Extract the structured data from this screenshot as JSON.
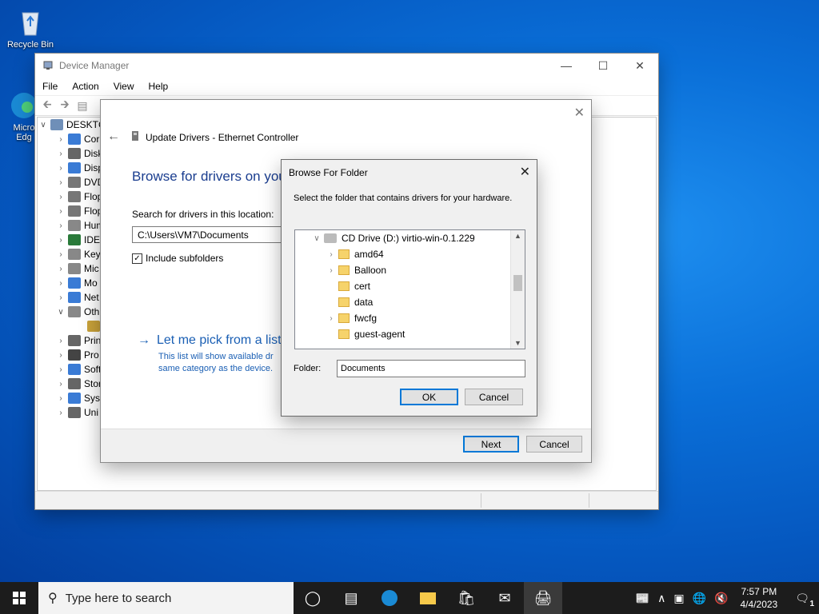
{
  "desktop": {
    "icons": [
      {
        "label": "Recycle Bin"
      },
      {
        "label": "Microsoft Edge",
        "label_line1": "Micro",
        "label_line2": "Edg"
      }
    ]
  },
  "device_manager": {
    "title": "Device Manager",
    "menu": [
      "File",
      "Action",
      "View",
      "Help"
    ],
    "tree": {
      "root": "DESKTC",
      "items": [
        "Cor",
        "Disk",
        "Disp",
        "DVD",
        "Flop",
        "Flop",
        "Hum",
        "IDE",
        "Key",
        "Mic",
        "Mo",
        "Net",
        "Oth",
        "",
        "Prin",
        "Pro",
        "Soft",
        "Stor",
        "Syst",
        "Uni"
      ]
    }
  },
  "update_drivers": {
    "header": "Update Drivers - Ethernet Controller",
    "heading": "Browse for drivers on your",
    "location_label": "Search for drivers in this location:",
    "path_value": "C:\\Users\\VM7\\Documents",
    "include_subfolders": "Include subfolders",
    "pick_link": "Let me pick from a list",
    "pick_desc_line1": "This list will show available dr",
    "pick_desc_line2": "same category as the device.",
    "next": "Next",
    "cancel": "Cancel"
  },
  "browse": {
    "title": "Browse For Folder",
    "message": "Select the folder that contains drivers for your hardware.",
    "drive": "CD Drive (D:) virtio-win-0.1.229",
    "folders": [
      {
        "name": "amd64",
        "expandable": true
      },
      {
        "name": "Balloon",
        "expandable": true
      },
      {
        "name": "cert",
        "expandable": false
      },
      {
        "name": "data",
        "expandable": false
      },
      {
        "name": "fwcfg",
        "expandable": true
      },
      {
        "name": "guest-agent",
        "expandable": false
      }
    ],
    "folder_label": "Folder:",
    "folder_value": "Documents",
    "ok": "OK",
    "cancel": "Cancel"
  },
  "taskbar": {
    "search_placeholder": "Type here to search",
    "time": "7:57 PM",
    "date": "4/4/2023",
    "notification_count": "1"
  }
}
